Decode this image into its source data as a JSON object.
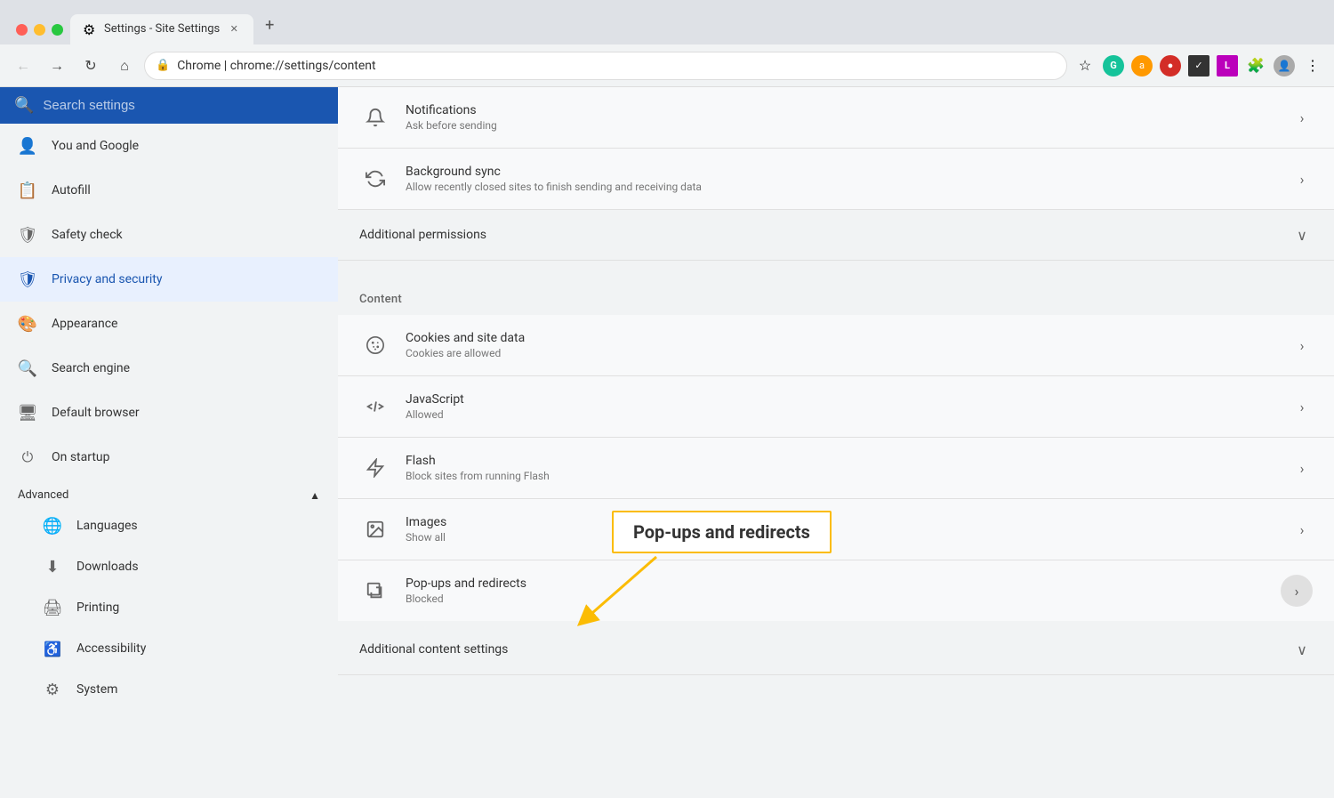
{
  "browser": {
    "tab_title": "Settings - Site Settings",
    "tab_icon": "⚙",
    "new_tab_icon": "+",
    "nav": {
      "back": "←",
      "forward": "→",
      "refresh": "↻",
      "home": "⌂",
      "address_domain": "Chrome",
      "address_separator": "|",
      "address_url": "chrome://settings/content",
      "star_icon": "☆",
      "more_icon": "⋮"
    }
  },
  "settings": {
    "title": "Settings",
    "search_placeholder": "Search settings"
  },
  "sidebar": {
    "items": [
      {
        "id": "you-and-google",
        "label": "You and Google",
        "icon": "person"
      },
      {
        "id": "autofill",
        "label": "Autofill",
        "icon": "autofill"
      },
      {
        "id": "safety-check",
        "label": "Safety check",
        "icon": "shield"
      },
      {
        "id": "privacy-and-security",
        "label": "Privacy and security",
        "icon": "privacy",
        "active": true
      },
      {
        "id": "appearance",
        "label": "Appearance",
        "icon": "appearance"
      },
      {
        "id": "search-engine",
        "label": "Search engine",
        "icon": "search"
      },
      {
        "id": "default-browser",
        "label": "Default browser",
        "icon": "browser"
      },
      {
        "id": "on-startup",
        "label": "On startup",
        "icon": "startup"
      }
    ],
    "advanced": {
      "label": "Advanced",
      "expanded": true,
      "chevron": "▲",
      "sub_items": [
        {
          "id": "languages",
          "label": "Languages",
          "icon": "language"
        },
        {
          "id": "downloads",
          "label": "Downloads",
          "icon": "download"
        },
        {
          "id": "printing",
          "label": "Printing",
          "icon": "print"
        },
        {
          "id": "accessibility",
          "label": "Accessibility",
          "icon": "access"
        },
        {
          "id": "system",
          "label": "System",
          "icon": "system"
        }
      ]
    }
  },
  "content": {
    "rows_top": [
      {
        "id": "notifications",
        "icon": "bell",
        "title": "Notifications",
        "subtitle": "Ask before sending",
        "chevron": "›"
      },
      {
        "id": "background-sync",
        "icon": "sync",
        "title": "Background sync",
        "subtitle": "Allow recently closed sites to finish sending and receiving data",
        "chevron": "›"
      }
    ],
    "additional_permissions": {
      "label": "Additional permissions",
      "chevron": "∨"
    },
    "content_section": {
      "label": "Content"
    },
    "content_rows": [
      {
        "id": "cookies",
        "icon": "cookie",
        "title": "Cookies and site data",
        "subtitle": "Cookies are allowed",
        "chevron": "›"
      },
      {
        "id": "javascript",
        "icon": "js",
        "title": "JavaScript",
        "subtitle": "Allowed",
        "chevron": "›"
      },
      {
        "id": "flash",
        "icon": "flash",
        "title": "Flash",
        "subtitle": "Block sites from running Flash",
        "chevron": "›"
      },
      {
        "id": "images",
        "icon": "image",
        "title": "Images",
        "subtitle": "Show all",
        "chevron": "›"
      },
      {
        "id": "popups",
        "icon": "popup",
        "title": "Pop-ups and redirects",
        "subtitle": "Blocked",
        "chevron": "›",
        "highlighted": true
      }
    ],
    "additional_content_settings": {
      "label": "Additional content settings",
      "chevron": "∨"
    },
    "tooltip": {
      "label": "Pop-ups and redirects"
    }
  }
}
